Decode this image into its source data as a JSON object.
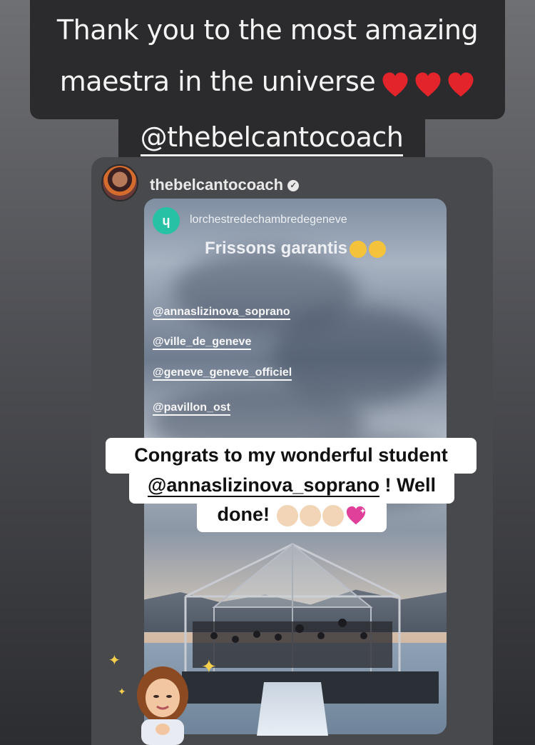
{
  "caption": {
    "line1": "Thank you to the most amazing",
    "line2": "maestra in the universe",
    "mention": "@thebelcantocoach"
  },
  "reshare": {
    "author_handle": "thebelcantocoach",
    "verified": true
  },
  "inner_story": {
    "account": "lorchestredechambredegeneve",
    "headline": "Frissons garantis",
    "tags": [
      "@annaslizinova_soprano",
      "@ville_de_geneve",
      "@geneve_geneve_officiel",
      "@pavillon_ost"
    ]
  },
  "congrats": {
    "line1": "Congrats to my wonderful student",
    "mention": "@annaslizinova_soprano",
    "line2_suffix": " ! Well",
    "line3": "done!"
  },
  "colors": {
    "caption_bg": "#2b2b2d",
    "heart": "#e3242b",
    "logo_teal": "#27c2a6"
  },
  "icons": [
    "heart-icon",
    "verified-icon",
    "clap-icon",
    "sparkling-heart-icon",
    "heart-eyes-emoji",
    "star-struck-emoji"
  ]
}
